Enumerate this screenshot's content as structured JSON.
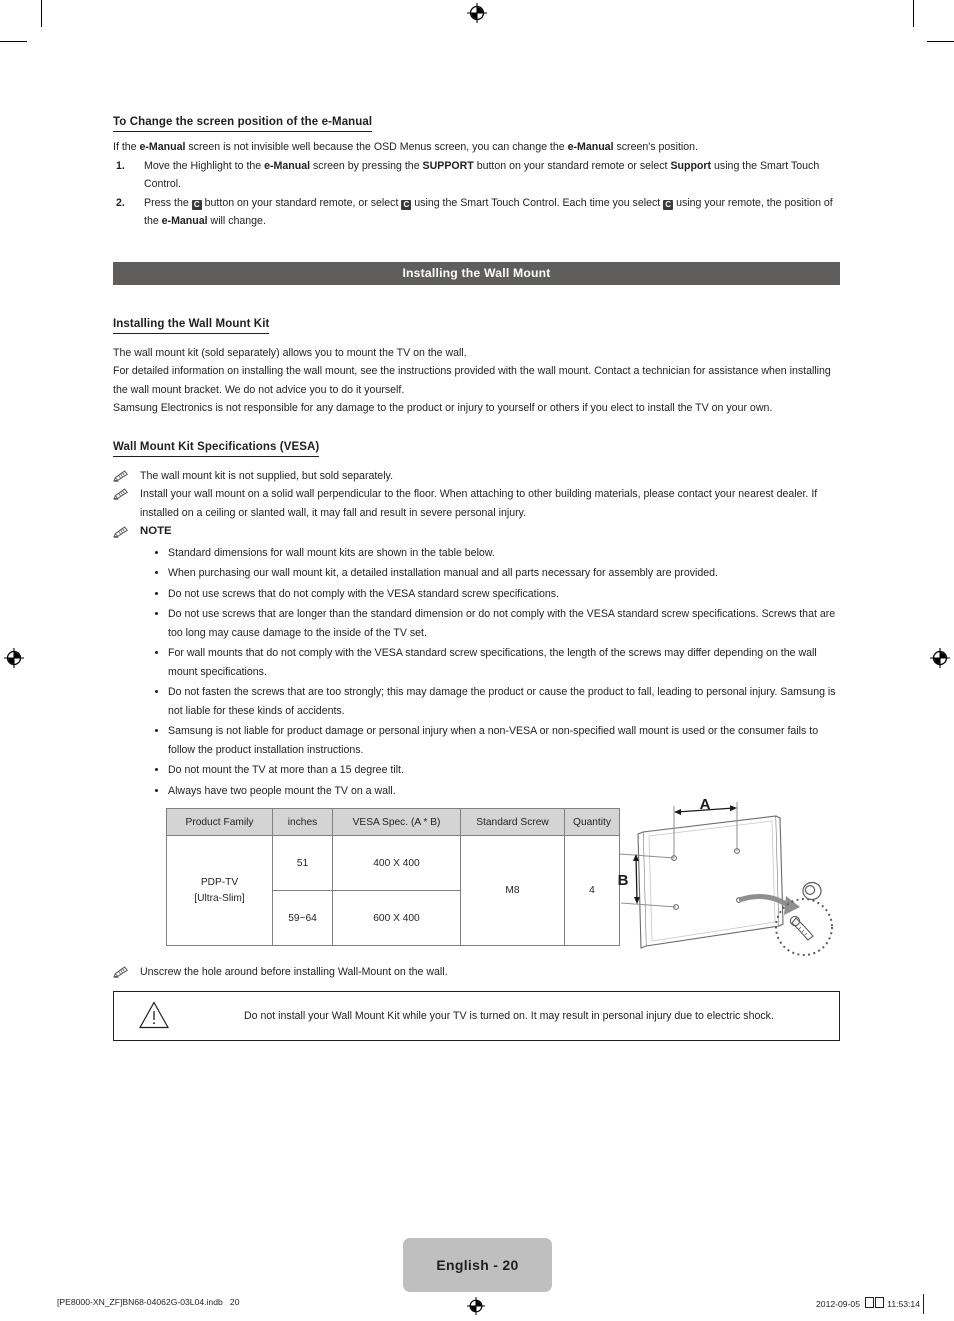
{
  "document": {
    "title": "Samsung PDP-TV e-Manual / Wall Mount Installation",
    "page_label": "English - 20"
  },
  "section_emanual": {
    "heading": "To Change the screen position of the e-Manual",
    "intro_parts": {
      "p1": "If the ",
      "b1": "e-Manual",
      "p2": " screen is not invisible well because the OSD Menus screen, you can change the ",
      "b2": "e-Manual",
      "p3": " screen's position."
    },
    "steps": [
      {
        "number": "1.",
        "parts": {
          "t1": "Move the Highlight to the ",
          "b1": "e-Manual",
          "t2": " screen by pressing the ",
          "b2": "SUPPORT",
          "t3": " button on your standard remote or select ",
          "b3": "Support",
          "t4": " using the Smart Touch Control."
        }
      },
      {
        "number": "2.",
        "parts": {
          "t1": "Press the ",
          "key1": "C",
          "t2": " button on your standard remote, or select ",
          "key2": "C",
          "t3": " using the Smart Touch Control. Each time you select ",
          "key3": "C",
          "t4": " using your remote, the position of the ",
          "b1": "e-Manual",
          "t5": " will change."
        }
      }
    ]
  },
  "banner": {
    "label": "Installing the Wall Mount",
    "background": "#605d5d",
    "text_color": "#ffffff"
  },
  "section_kit": {
    "heading": "Installing the Wall Mount Kit",
    "paragraphs": [
      "The wall mount kit (sold separately) allows you to mount the TV on the wall.",
      "For detailed information on installing the wall mount, see the instructions provided with the wall mount. Contact a technician for assistance when installing the wall mount bracket. We do not advice you to do it yourself.",
      "Samsung Electronics is not responsible for any damage to the product or injury to yourself or others if you elect to install the TV on your own."
    ]
  },
  "section_vesa": {
    "heading": "Wall Mount Kit Specifications (VESA)",
    "notes": [
      "The wall mount kit is not supplied, but sold separately.",
      "Install your wall mount on a solid wall perpendicular to the floor. When attaching to other building materials, please contact your nearest dealer. If installed on a ceiling or slanted wall, it may fall and result in severe personal injury."
    ],
    "note_title": "NOTE",
    "bullets": [
      "Standard dimensions for wall mount kits are shown in the table below.",
      "When purchasing our wall mount kit, a detailed installation manual and all parts necessary for assembly are provided.",
      "Do not use screws that do not comply with the VESA standard screw specifications.",
      "Do not use screws that are longer than the standard dimension or do not comply with the VESA standard screw specifications. Screws that are too long may cause damage to the inside of the TV set.",
      "For wall mounts that do not comply with the VESA standard screw specifications, the length of the screws may differ depending on the wall mount specifications.",
      "Do not fasten the screws that are too strongly; this may damage the product or cause the product to fall, leading to personal injury. Samsung is not liable for these kinds of accidents.",
      "Samsung is not liable for product damage or personal injury when a non-VESA or non-specified wall mount is used or the consumer fails to follow the product installation instructions.",
      "Do not mount the TV at more than a 15 degree tilt.",
      "Always have two people mount the TV on a wall."
    ]
  },
  "vesa_table": {
    "headers": [
      "Product Family",
      "inches",
      "VESA Spec. (A * B)",
      "Standard Screw",
      "Quantity"
    ],
    "product_family": "PDP-TV",
    "product_family_line2": "[Ultra-Slim]",
    "rows": [
      {
        "inches": "51",
        "vesa_spec": "400 X 400"
      },
      {
        "inches": "59~64",
        "vesa_spec": "600 X 400"
      }
    ],
    "standard_screw": "M8",
    "quantity": "4",
    "header_background": "#d4d4d4"
  },
  "figure": {
    "label_a": "A",
    "label_b": "B"
  },
  "footer_note": "Unscrew the hole around before installing Wall-Mount on the wall.",
  "warning": {
    "text": "Do not install your Wall Mount Kit while your TV is turned on. It may result in personal injury due to electric shock."
  },
  "print_footer": {
    "file_label": "[PE8000-XN_ZF]BN68-04062G-03L04.indb   20",
    "date": "2012-09-05",
    "time": "11:53:14"
  }
}
